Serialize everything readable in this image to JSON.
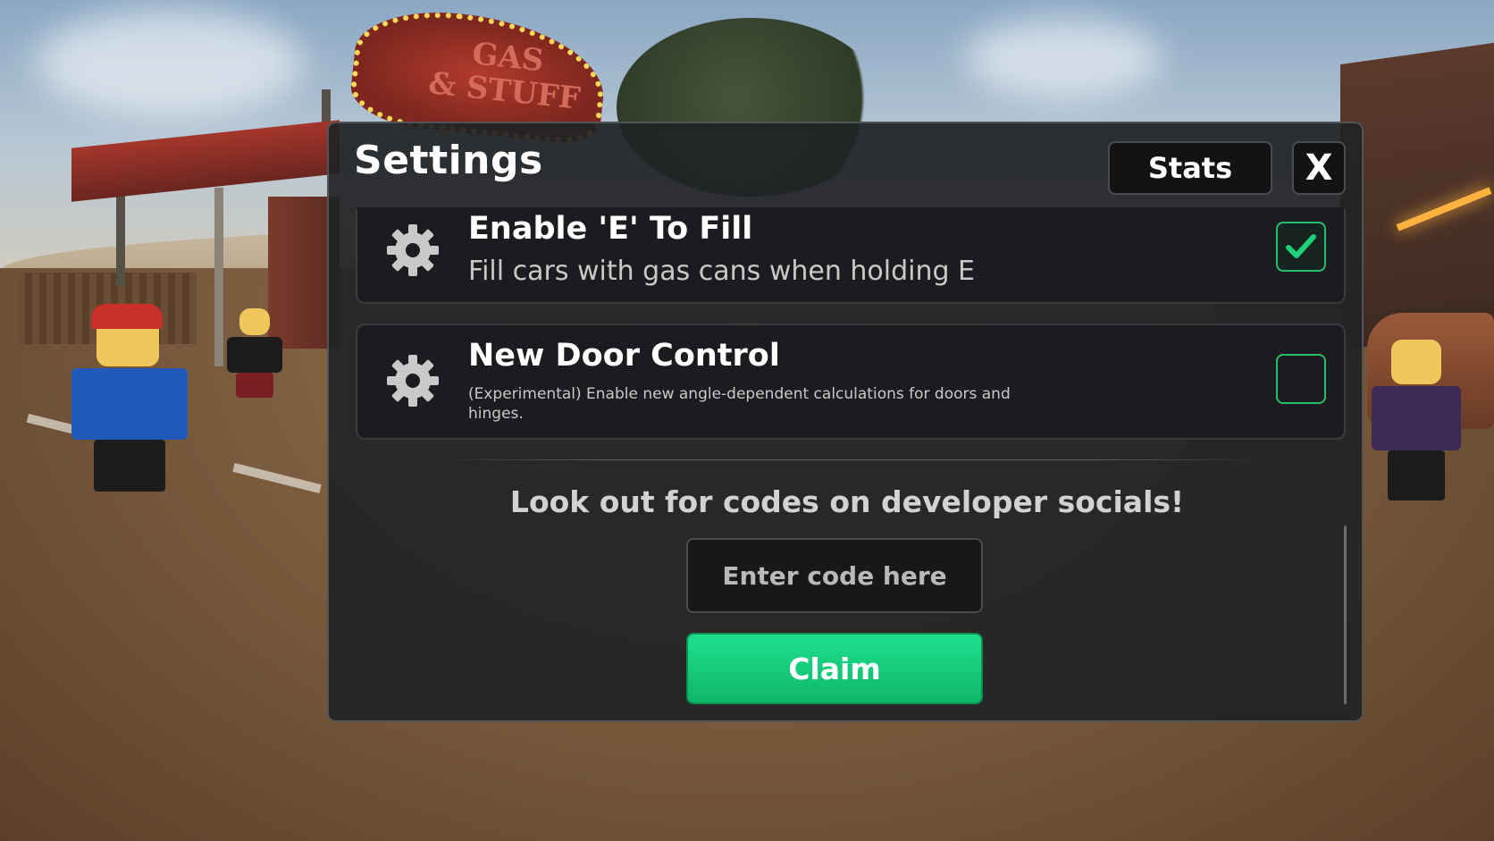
{
  "settings": {
    "title": "Settings",
    "stats_label": "Stats",
    "close_label": "X",
    "options": [
      {
        "title": "Enable 'E' To Fill",
        "description": "Fill cars with gas cans when holding E",
        "checked": true,
        "icon": "gear-icon"
      },
      {
        "title": "New Door Control",
        "description": "(Experimental) Enable new angle-dependent calculations for doors and hinges.",
        "checked": false,
        "icon": "gear-icon"
      }
    ],
    "codes": {
      "heading": "Look out for codes on developer socials!",
      "input_placeholder": "Enter code here",
      "claim_label": "Claim"
    }
  },
  "scene": {
    "sign_text": "GAS & STUFF"
  },
  "colors": {
    "accent_green": "#1ee08e",
    "checkbox_border": "#1fbf6b",
    "panel_bg": "#212326"
  }
}
